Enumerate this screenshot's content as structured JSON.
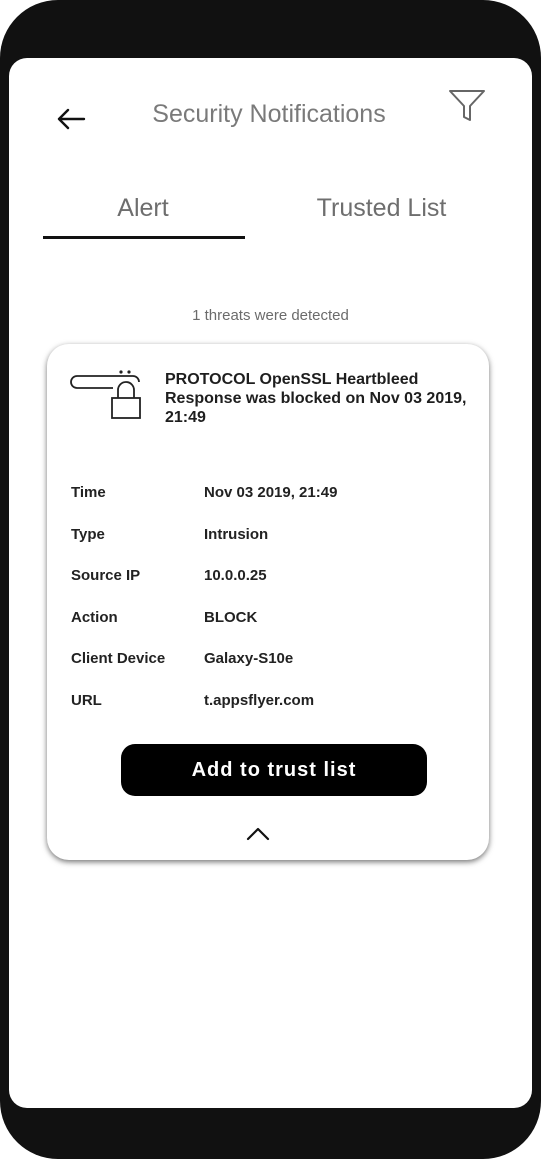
{
  "header": {
    "title": "Security Notifications",
    "back_icon": "arrow-left-icon",
    "filter_icon": "filter-icon"
  },
  "tabs": [
    {
      "label": "Alert",
      "active": true
    },
    {
      "label": "Trusted List",
      "active": false
    }
  ],
  "summary": "1 threats were detected",
  "alert": {
    "icon": "locked-device-icon",
    "headline": "PROTOCOL OpenSSL Heartbleed Response was blocked on Nov 03 2019, 21:49",
    "details": [
      {
        "label": "Time",
        "value": "Nov 03 2019, 21:49"
      },
      {
        "label": "Type",
        "value": "Intrusion"
      },
      {
        "label": "Source IP",
        "value": "10.0.0.25"
      },
      {
        "label": "Action",
        "value": "BLOCK"
      },
      {
        "label": "Client Device",
        "value": "Galaxy-S10e"
      },
      {
        "label": "URL",
        "value": "t.appsflyer.com"
      }
    ],
    "button_label": "Add to trust list",
    "collapse_icon": "chevron-up-icon"
  },
  "colors": {
    "frame": "#111111",
    "screen": "#ffffff",
    "button": "#000000",
    "muted_text": "#7a7a7a"
  }
}
